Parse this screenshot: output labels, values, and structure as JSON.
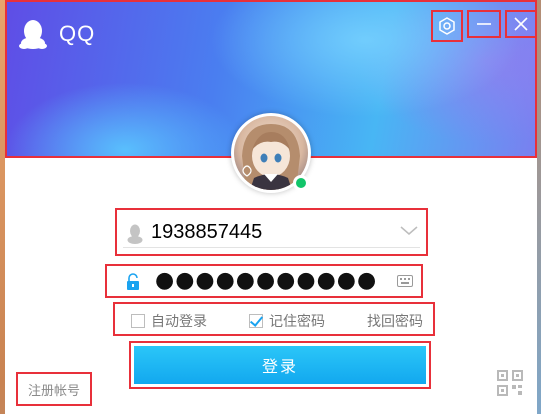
{
  "app": {
    "name": "QQ",
    "icons": {
      "logo": "qq-penguin-icon",
      "settings": "settings-hexagon-icon",
      "minimize": "minimize-icon",
      "close": "close-icon",
      "account": "user-silhouette-icon",
      "dropdown": "chevron-down-icon",
      "lock": "lock-icon",
      "keyboard": "keyboard-icon",
      "qr": "qr-code-icon"
    }
  },
  "login": {
    "account_value": "1938857445",
    "password_masked": "●●●●●●●●●●●",
    "auto_login_label": "自动登录",
    "auto_login_checked": false,
    "remember_password_label": "记住密码",
    "remember_password_checked": true,
    "find_password_label": "找回密码",
    "login_button_label": "登录",
    "register_label": "注册帐号"
  },
  "colors": {
    "accent": "#12a8ef",
    "status_online": "#12c56a",
    "highlight_outline": "#e8303a"
  }
}
